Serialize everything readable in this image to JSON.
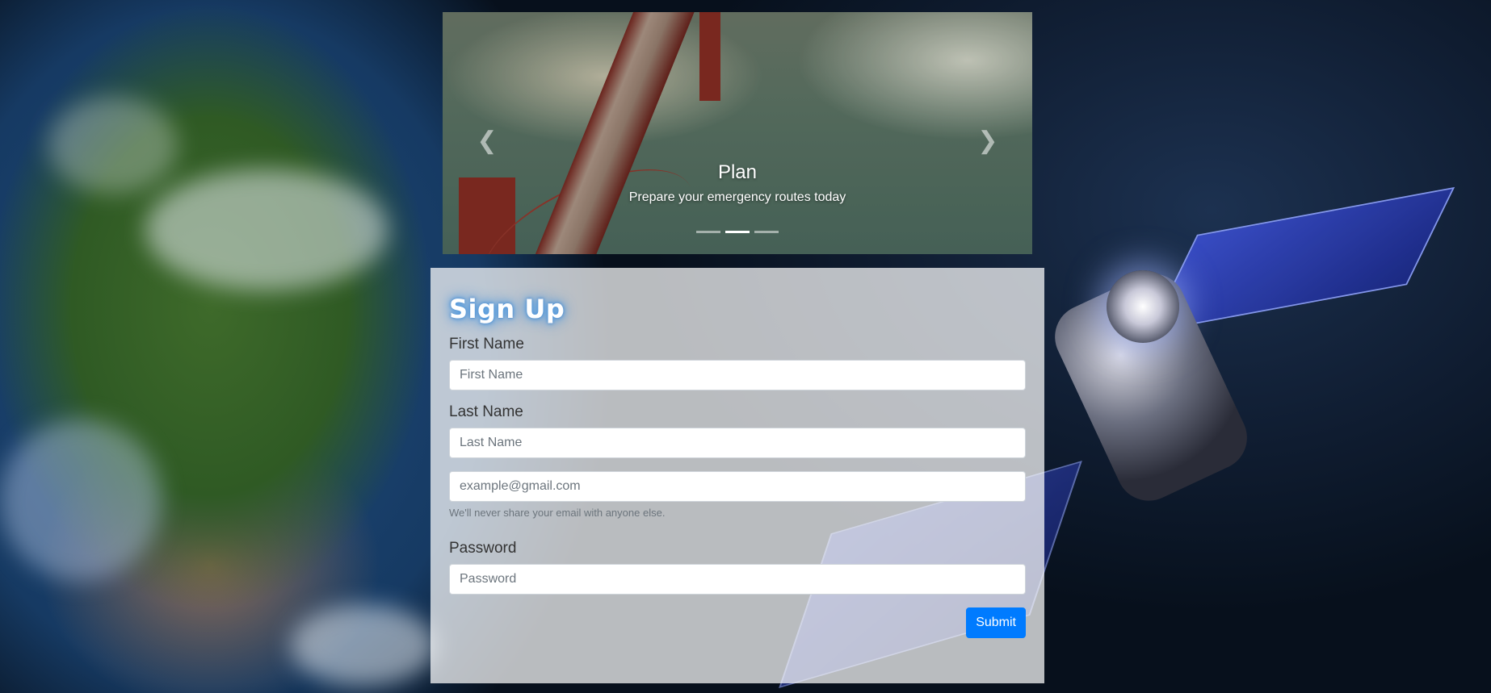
{
  "carousel": {
    "slide_title": "Plan",
    "slide_text": "Prepare your emergency routes today",
    "prev_icon": "chevron-left-icon",
    "next_icon": "chevron-right-icon",
    "indicators": [
      {
        "active": false
      },
      {
        "active": true
      },
      {
        "active": false
      }
    ]
  },
  "form": {
    "title": "Sign Up",
    "first_name_label": "First Name",
    "first_name_placeholder": "First Name",
    "last_name_label": "Last Name",
    "last_name_placeholder": "Last Name",
    "email_placeholder": "example@gmail.com",
    "email_help": "We'll never share your email with anyone else.",
    "password_label": "Password",
    "password_placeholder": "Password",
    "submit_label": "Submit"
  },
  "colors": {
    "primary": "#007bff",
    "title_glow": "#5ba4e6"
  }
}
